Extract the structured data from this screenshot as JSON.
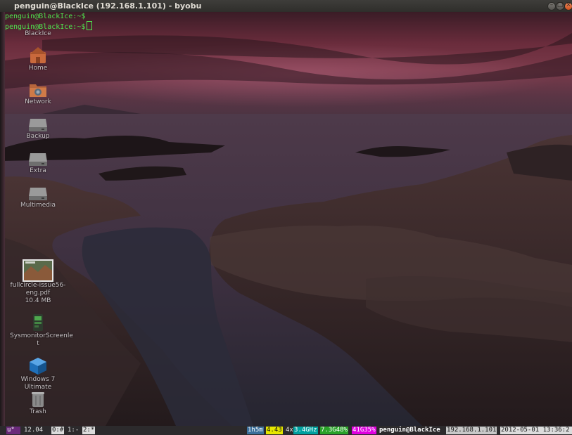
{
  "window": {
    "title": "penguin@BlackIce (192.168.1.101) - byobu",
    "buttons": [
      "–",
      "□",
      "×"
    ]
  },
  "terminal": {
    "lines": [
      "penguin@BlackIce:~$",
      "penguin@BlackIce:~$"
    ]
  },
  "desktop_icons": [
    {
      "label": "BlackIce",
      "icon": "computer-icon"
    },
    {
      "label": "Home",
      "icon": "home-folder-icon"
    },
    {
      "label": "Network",
      "icon": "network-folder-icon"
    },
    {
      "label": "Backup",
      "icon": "drive-icon"
    },
    {
      "label": "Extra",
      "icon": "drive-icon"
    },
    {
      "label": "Multimedia",
      "icon": "drive-icon"
    },
    {
      "label": "fullcircle-issue56-eng.pdf",
      "label_lines": [
        "fullcircle-issue56-",
        "eng.pdf"
      ],
      "size": "10.4 MB",
      "icon": "pdf-thumbnail-icon"
    },
    {
      "label": "SysmonitorScreenlet",
      "label_lines": [
        "SysmonitorScreenle",
        "t"
      ],
      "icon": "screenlet-icon"
    },
    {
      "label": "Windows 7 Ultimate",
      "icon": "virtualbox-icon"
    },
    {
      "label": "Trash",
      "icon": "trash-icon"
    }
  ],
  "statusbar": {
    "logo": "u°",
    "release": "12.04",
    "windows": [
      "0:#",
      "1:-",
      "2:*"
    ],
    "uptime": "1h5m",
    "load": "4.43",
    "cpu_count": "4x",
    "cpu_freq": "3.4GHz",
    "memory": "7.3G48%",
    "disk": "41G35%",
    "user_host": "penguin@BlackIce",
    "ip": "192.168.1.101",
    "datetime": "2012-05-01 13:36:2"
  },
  "colors": {
    "prompt": "#4ee44e",
    "load_bg": "#e6e600",
    "cpu_bg": "#00a0a0",
    "mem_bg": "#2aa22a",
    "disk_bg": "#e000e0",
    "uptime_bg": "#3b6f9b"
  }
}
